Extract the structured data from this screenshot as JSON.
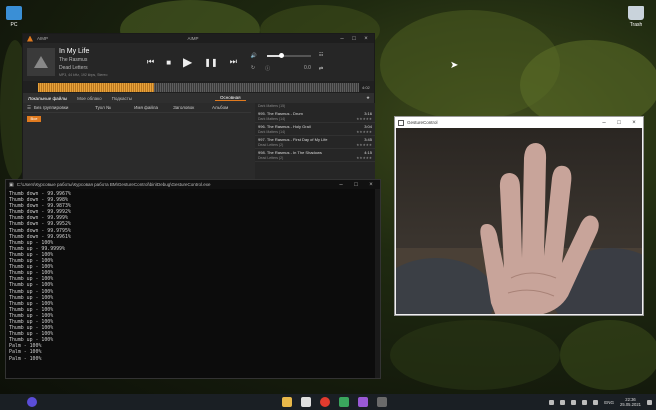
{
  "desktop": {
    "icons": [
      {
        "label": "PC",
        "icon": "computer-icon"
      },
      {
        "label": "Trash",
        "icon": "trash-icon"
      }
    ]
  },
  "aimp": {
    "title": "AIMP",
    "app_name": "AIMP",
    "track": {
      "title": "In My Life",
      "artist": "The Rasmus",
      "album": "Dead Letters",
      "meta": "MP3, 44 kHz, 192 kbps, Stereo"
    },
    "time_right": "4:02",
    "speed": "0.0",
    "tabs": [
      "Локальные файлы",
      "Мое облако",
      "Подкасты"
    ],
    "playlist_tab": "Основная",
    "library": {
      "group": "Без группировки",
      "columns": [
        "Тухл №",
        "Имя файла",
        "Заголовок",
        "Альбом"
      ],
      "all_label": "Все"
    },
    "playlist": {
      "top_item": "Dark Matters (15)",
      "items": [
        {
          "title": "995. The Rasmus - Drum",
          "album": "Dark Matters (14)",
          "duration": "3:16"
        },
        {
          "title": "996. The Rasmus - Holy Grail",
          "album": "Dark Matters (14)",
          "duration": "3:04"
        },
        {
          "title": "997. The Rasmus - First Day of My Life",
          "album": "Dead Letters (2)",
          "duration": "3:45"
        },
        {
          "title": "998. The Rasmus - In The Shadows",
          "album": "Dead Letters (2)",
          "duration": "4:15"
        }
      ]
    }
  },
  "console": {
    "title": "C:\\Users\\Курсовые работы\\Курсовая работа ВМ\\GestureControl\\bin\\Debug\\GestureControl.exe",
    "lines": [
      "Thumb down - 99.9967%",
      "Thumb down - 99.998%",
      "Thumb down - 99.9873%",
      "Thumb down - 99.9992%",
      "Thumb down - 99.999%",
      "Thumb down - 99.9952%",
      "Thumb down - 99.9795%",
      "Thumb down - 99.9961%",
      "Thumb up - 100%",
      "Thumb up - 99.9999%",
      "Thumb up - 100%",
      "Thumb up - 100%",
      "Thumb up - 100%",
      "Thumb up - 100%",
      "Thumb up - 100%",
      "Thumb up - 100%",
      "Thumb up - 100%",
      "Thumb up - 100%",
      "Thumb up - 100%",
      "Thumb up - 100%",
      "Thumb up - 100%",
      "Thumb up - 100%",
      "Thumb up - 100%",
      "Thumb up - 100%",
      "Thumb up - 100%",
      "Palm - 100%",
      "Palm - 100%",
      "Palm - 100%"
    ]
  },
  "gesture_window": {
    "title": "GestureControl"
  },
  "taskbar": {
    "language": "ENG",
    "time": "22:36",
    "date": "25.05.2021"
  }
}
